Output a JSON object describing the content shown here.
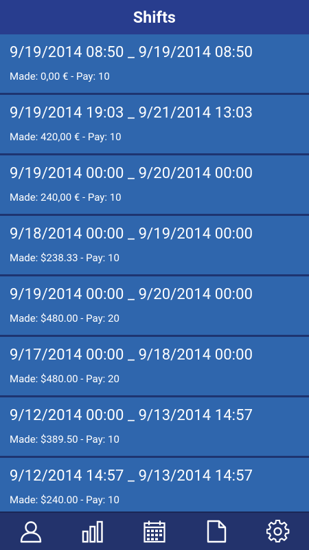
{
  "header": {
    "title": "Shifts"
  },
  "shifts": [
    {
      "range": "9/19/2014 08:50 _ 9/19/2014 08:50",
      "meta": "Made: 0,00 € - Pay: 10"
    },
    {
      "range": "9/19/2014 19:03 _ 9/21/2014 13:03",
      "meta": "Made: 420,00 € - Pay: 10"
    },
    {
      "range": "9/19/2014 00:00 _ 9/20/2014 00:00",
      "meta": "Made: 240,00 € - Pay: 10"
    },
    {
      "range": "9/18/2014 00:00 _ 9/19/2014 00:00",
      "meta": "Made: $238.33 - Pay: 10"
    },
    {
      "range": "9/19/2014 00:00 _ 9/20/2014 00:00",
      "meta": "Made: $480.00 - Pay: 20"
    },
    {
      "range": "9/17/2014 00:00 _ 9/18/2014 00:00",
      "meta": "Made: $480.00 - Pay: 20"
    },
    {
      "range": "9/12/2014 00:00 _ 9/13/2014 14:57",
      "meta": "Made: $389.50 - Pay: 10"
    },
    {
      "range": "9/12/2014 14:57 _ 9/13/2014 14:57",
      "meta": "Made: $240.00 - Pay: 10"
    }
  ],
  "tabbar": {
    "tabs": [
      {
        "icon": "person-icon"
      },
      {
        "icon": "bar-chart-icon"
      },
      {
        "icon": "calendar-icon"
      },
      {
        "icon": "document-icon"
      },
      {
        "icon": "gear-icon"
      }
    ]
  },
  "colors": {
    "header_bg": "#283d8e",
    "row_bg": "#2f66ad",
    "row_divider": "#1e3470",
    "tabbar_bg": "#23336c",
    "text": "#ffffff"
  }
}
